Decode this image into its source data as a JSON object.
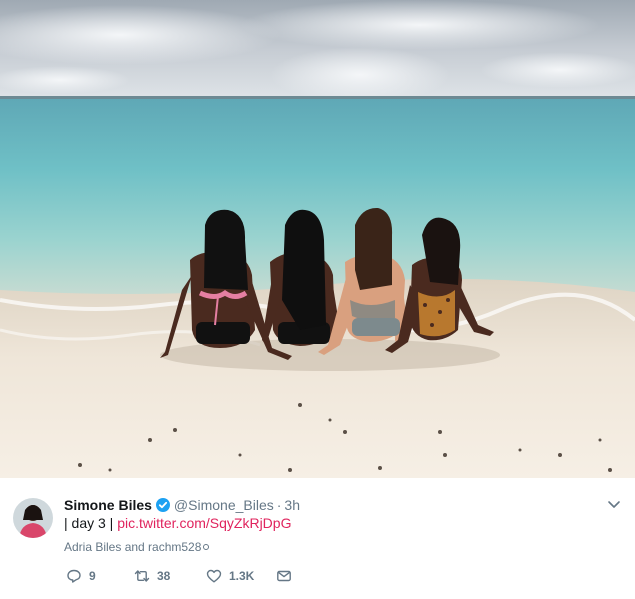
{
  "photo": {
    "alt": "day 3",
    "icon": "beach-photo"
  },
  "tweet": {
    "author_name": "Simone Biles",
    "verified_icon": "verified-badge-icon",
    "handle": "@Simone_Biles",
    "separator": "·",
    "time": "3h",
    "text_prefix": "| day 3 | ",
    "link_text": "pic.twitter.com/SqyZkRjDpG",
    "tagged": "Adria Biles and rachm528",
    "accent_color": "#e0245e",
    "verified_color": "#1da1f2",
    "actions": {
      "reply_count": "9",
      "retweet_count": "38",
      "like_count": "1.3K"
    }
  }
}
